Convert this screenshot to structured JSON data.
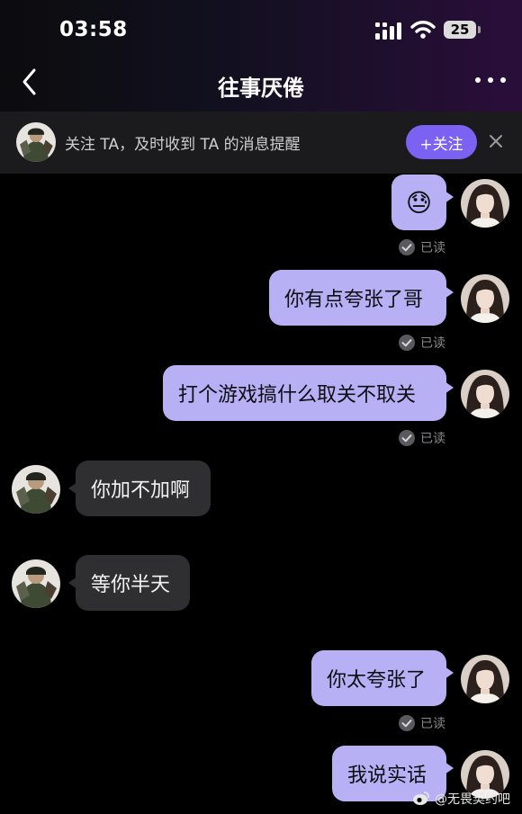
{
  "status_bar": {
    "time": "03:58",
    "battery": "25"
  },
  "header": {
    "title": "往事厌倦"
  },
  "follow_prompt": {
    "text": "关注 TA，及时收到 TA 的消息提醒",
    "button_label": "+关注"
  },
  "messages": [
    {
      "sender": "me",
      "text": "😓",
      "read": "已读"
    },
    {
      "sender": "me",
      "text": "你有点夸张了哥",
      "read": "已读"
    },
    {
      "sender": "me",
      "text": "打个游戏搞什么取关不取关",
      "read": "已读"
    },
    {
      "sender": "them",
      "text": "你加不加啊"
    },
    {
      "sender": "them",
      "text": "等你半天"
    },
    {
      "sender": "me",
      "text": "你太夸张了",
      "read": "已读"
    },
    {
      "sender": "me",
      "text": "我说实话"
    }
  ],
  "watermark": {
    "text": "@无畏契约吧"
  },
  "colors": {
    "my_bubble": "#b7b0f4",
    "their_bubble": "#2f2f31",
    "follow_button": "#7b62f3",
    "background": "#000000"
  }
}
